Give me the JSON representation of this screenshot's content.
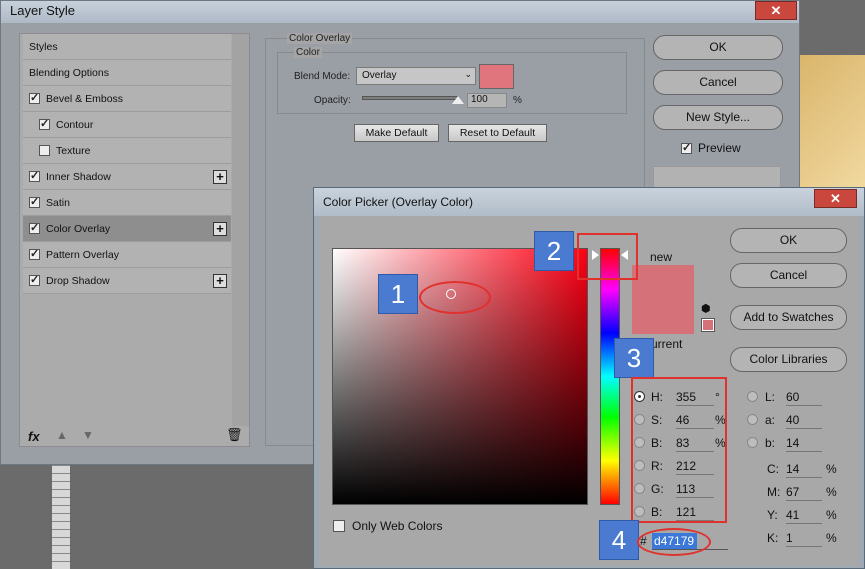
{
  "layer_style": {
    "title": "Layer Style",
    "styles": [
      {
        "label": "Styles",
        "checkbox": false,
        "checked": false,
        "plus": false,
        "selected": false,
        "indent": false
      },
      {
        "label": "Blending Options",
        "checkbox": false,
        "checked": false,
        "plus": false,
        "selected": false,
        "indent": false
      },
      {
        "label": "Bevel & Emboss",
        "checkbox": true,
        "checked": true,
        "plus": false,
        "selected": false,
        "indent": false
      },
      {
        "label": "Contour",
        "checkbox": true,
        "checked": true,
        "plus": false,
        "selected": false,
        "indent": true
      },
      {
        "label": "Texture",
        "checkbox": true,
        "checked": false,
        "plus": false,
        "selected": false,
        "indent": true
      },
      {
        "label": "Inner Shadow",
        "checkbox": true,
        "checked": true,
        "plus": true,
        "selected": false,
        "indent": false
      },
      {
        "label": "Satin",
        "checkbox": true,
        "checked": true,
        "plus": false,
        "selected": false,
        "indent": false
      },
      {
        "label": "Color Overlay",
        "checkbox": true,
        "checked": true,
        "plus": true,
        "selected": true,
        "indent": false
      },
      {
        "label": "Pattern Overlay",
        "checkbox": true,
        "checked": true,
        "plus": false,
        "selected": false,
        "indent": false
      },
      {
        "label": "Drop Shadow",
        "checkbox": true,
        "checked": true,
        "plus": true,
        "selected": false,
        "indent": false
      }
    ],
    "footer": {
      "fx": "fx",
      "up_icon": "arrow-up-icon",
      "down_icon": "arrow-down-icon",
      "trash_icon": "trash-icon"
    },
    "color_overlay": {
      "group_title": "Color Overlay",
      "subgroup_title": "Color",
      "blend_mode_label": "Blend Mode:",
      "blend_mode_value": "Overlay",
      "opacity_label": "Opacity:",
      "opacity_value": "100",
      "opacity_unit": "%",
      "overlay_color": "#e0757e",
      "make_default": "Make Default",
      "reset_default": "Reset to Default"
    },
    "buttons": {
      "ok": "OK",
      "cancel": "Cancel",
      "new_style": "New Style...",
      "preview": "Preview"
    }
  },
  "color_picker": {
    "title": "Color Picker (Overlay Color)",
    "buttons": {
      "ok": "OK",
      "cancel": "Cancel",
      "add_swatches": "Add to Swatches",
      "color_libraries": "Color Libraries"
    },
    "new_label": "new",
    "current_label": "current",
    "new_color": "#d47179",
    "current_color": "#d47179",
    "only_web_colors": "Only Web Colors",
    "fields_left": [
      {
        "label": "H:",
        "value": "355",
        "unit": "°",
        "radio": true,
        "selected": true
      },
      {
        "label": "S:",
        "value": "46",
        "unit": "%",
        "radio": true,
        "selected": false
      },
      {
        "label": "B:",
        "value": "83",
        "unit": "%",
        "radio": true,
        "selected": false
      },
      {
        "label": "R:",
        "value": "212",
        "unit": "",
        "radio": true,
        "selected": false
      },
      {
        "label": "G:",
        "value": "113",
        "unit": "",
        "radio": true,
        "selected": false
      },
      {
        "label": "B:",
        "value": "121",
        "unit": "",
        "radio": true,
        "selected": false
      }
    ],
    "fields_right": [
      {
        "label": "L:",
        "value": "60",
        "unit": "",
        "radio": true
      },
      {
        "label": "a:",
        "value": "40",
        "unit": "",
        "radio": true
      },
      {
        "label": "b:",
        "value": "14",
        "unit": "",
        "radio": true
      },
      {
        "label": "C:",
        "value": "14",
        "unit": "%",
        "radio": false
      },
      {
        "label": "M:",
        "value": "67",
        "unit": "%",
        "radio": false
      },
      {
        "label": "Y:",
        "value": "41",
        "unit": "%",
        "radio": false
      },
      {
        "label": "K:",
        "value": "1",
        "unit": "%",
        "radio": false
      }
    ],
    "hex_prefix": "#",
    "hex_value": "d47179"
  },
  "annotations": [
    "1",
    "2",
    "3",
    "4"
  ]
}
